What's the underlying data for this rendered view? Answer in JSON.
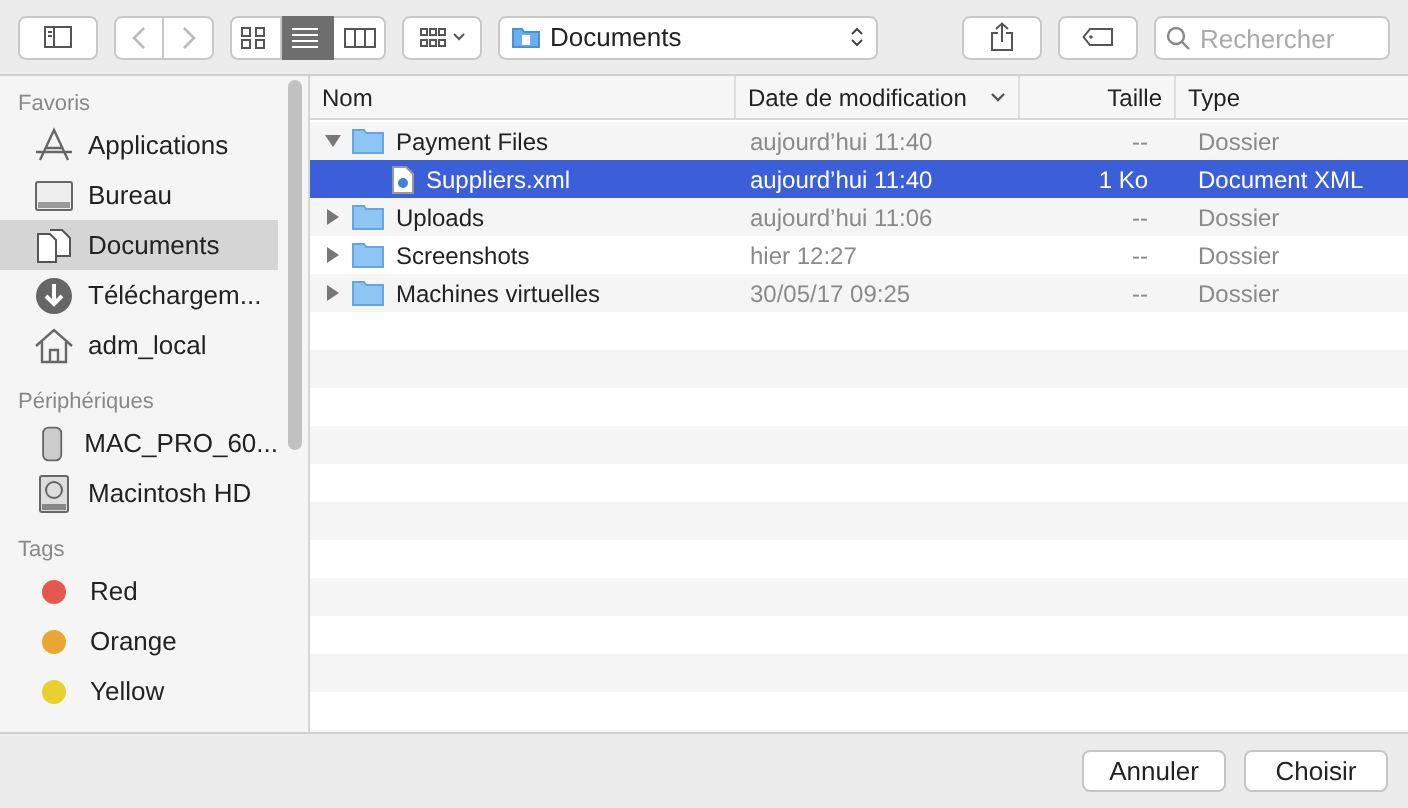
{
  "toolbar": {
    "view_modes": [
      {
        "kind": "icons",
        "selected": false
      },
      {
        "kind": "list",
        "selected": true
      },
      {
        "kind": "columns",
        "selected": false
      }
    ],
    "location": "Documents",
    "search": {
      "placeholder": "Rechercher"
    }
  },
  "sidebar": {
    "sections": [
      {
        "title": "Favoris",
        "items": [
          {
            "label": "Applications",
            "kind": "apps",
            "selected": false
          },
          {
            "label": "Bureau",
            "kind": "desktop",
            "selected": false
          },
          {
            "label": "Documents",
            "kind": "documents",
            "selected": true
          },
          {
            "label": "Téléchargem...",
            "kind": "downloads",
            "selected": false
          },
          {
            "label": "adm_local",
            "kind": "home",
            "selected": false
          }
        ]
      },
      {
        "title": "Périphériques",
        "items": [
          {
            "label": "MAC_PRO_60...",
            "kind": "computer",
            "selected": false
          },
          {
            "label": "Macintosh HD",
            "kind": "disk",
            "selected": false
          }
        ]
      },
      {
        "title": "Tags",
        "items": [
          {
            "label": "Red",
            "kind": "tag",
            "color": "#e5584f",
            "selected": false
          },
          {
            "label": "Orange",
            "kind": "tag",
            "color": "#eaa634",
            "selected": false
          },
          {
            "label": "Yellow",
            "kind": "tag",
            "color": "#e8d12f",
            "selected": false
          }
        ]
      }
    ]
  },
  "table": {
    "columns": [
      {
        "label": "Nom",
        "sorted": false
      },
      {
        "label": "Date de modification",
        "sorted": true
      },
      {
        "label": "Taille",
        "sorted": false
      },
      {
        "label": "Type",
        "sorted": false
      }
    ],
    "rows": [
      {
        "name": "Payment Files",
        "kind": "folder",
        "expanded": true,
        "selected": false,
        "date": "aujourd’hui 11:40",
        "size": "--",
        "type": "Dossier",
        "children": [
          {
            "name": "Suppliers.xml",
            "kind": "file",
            "selected": true,
            "date": "aujourd’hui 11:40",
            "size": "1 Ko",
            "type": "Document XML"
          }
        ]
      },
      {
        "name": "Uploads",
        "kind": "folder",
        "expanded": false,
        "selected": false,
        "date": "aujourd’hui 11:06",
        "size": "--",
        "type": "Dossier"
      },
      {
        "name": "Screenshots",
        "kind": "folder",
        "expanded": false,
        "selected": false,
        "date": "hier 12:27",
        "size": "--",
        "type": "Dossier"
      },
      {
        "name": "Machines virtuelles",
        "kind": "folder",
        "expanded": false,
        "selected": false,
        "date": "30/05/17 09:25",
        "size": "--",
        "type": "Dossier"
      }
    ]
  },
  "buttons": [
    "Annuler",
    "Choisir"
  ]
}
